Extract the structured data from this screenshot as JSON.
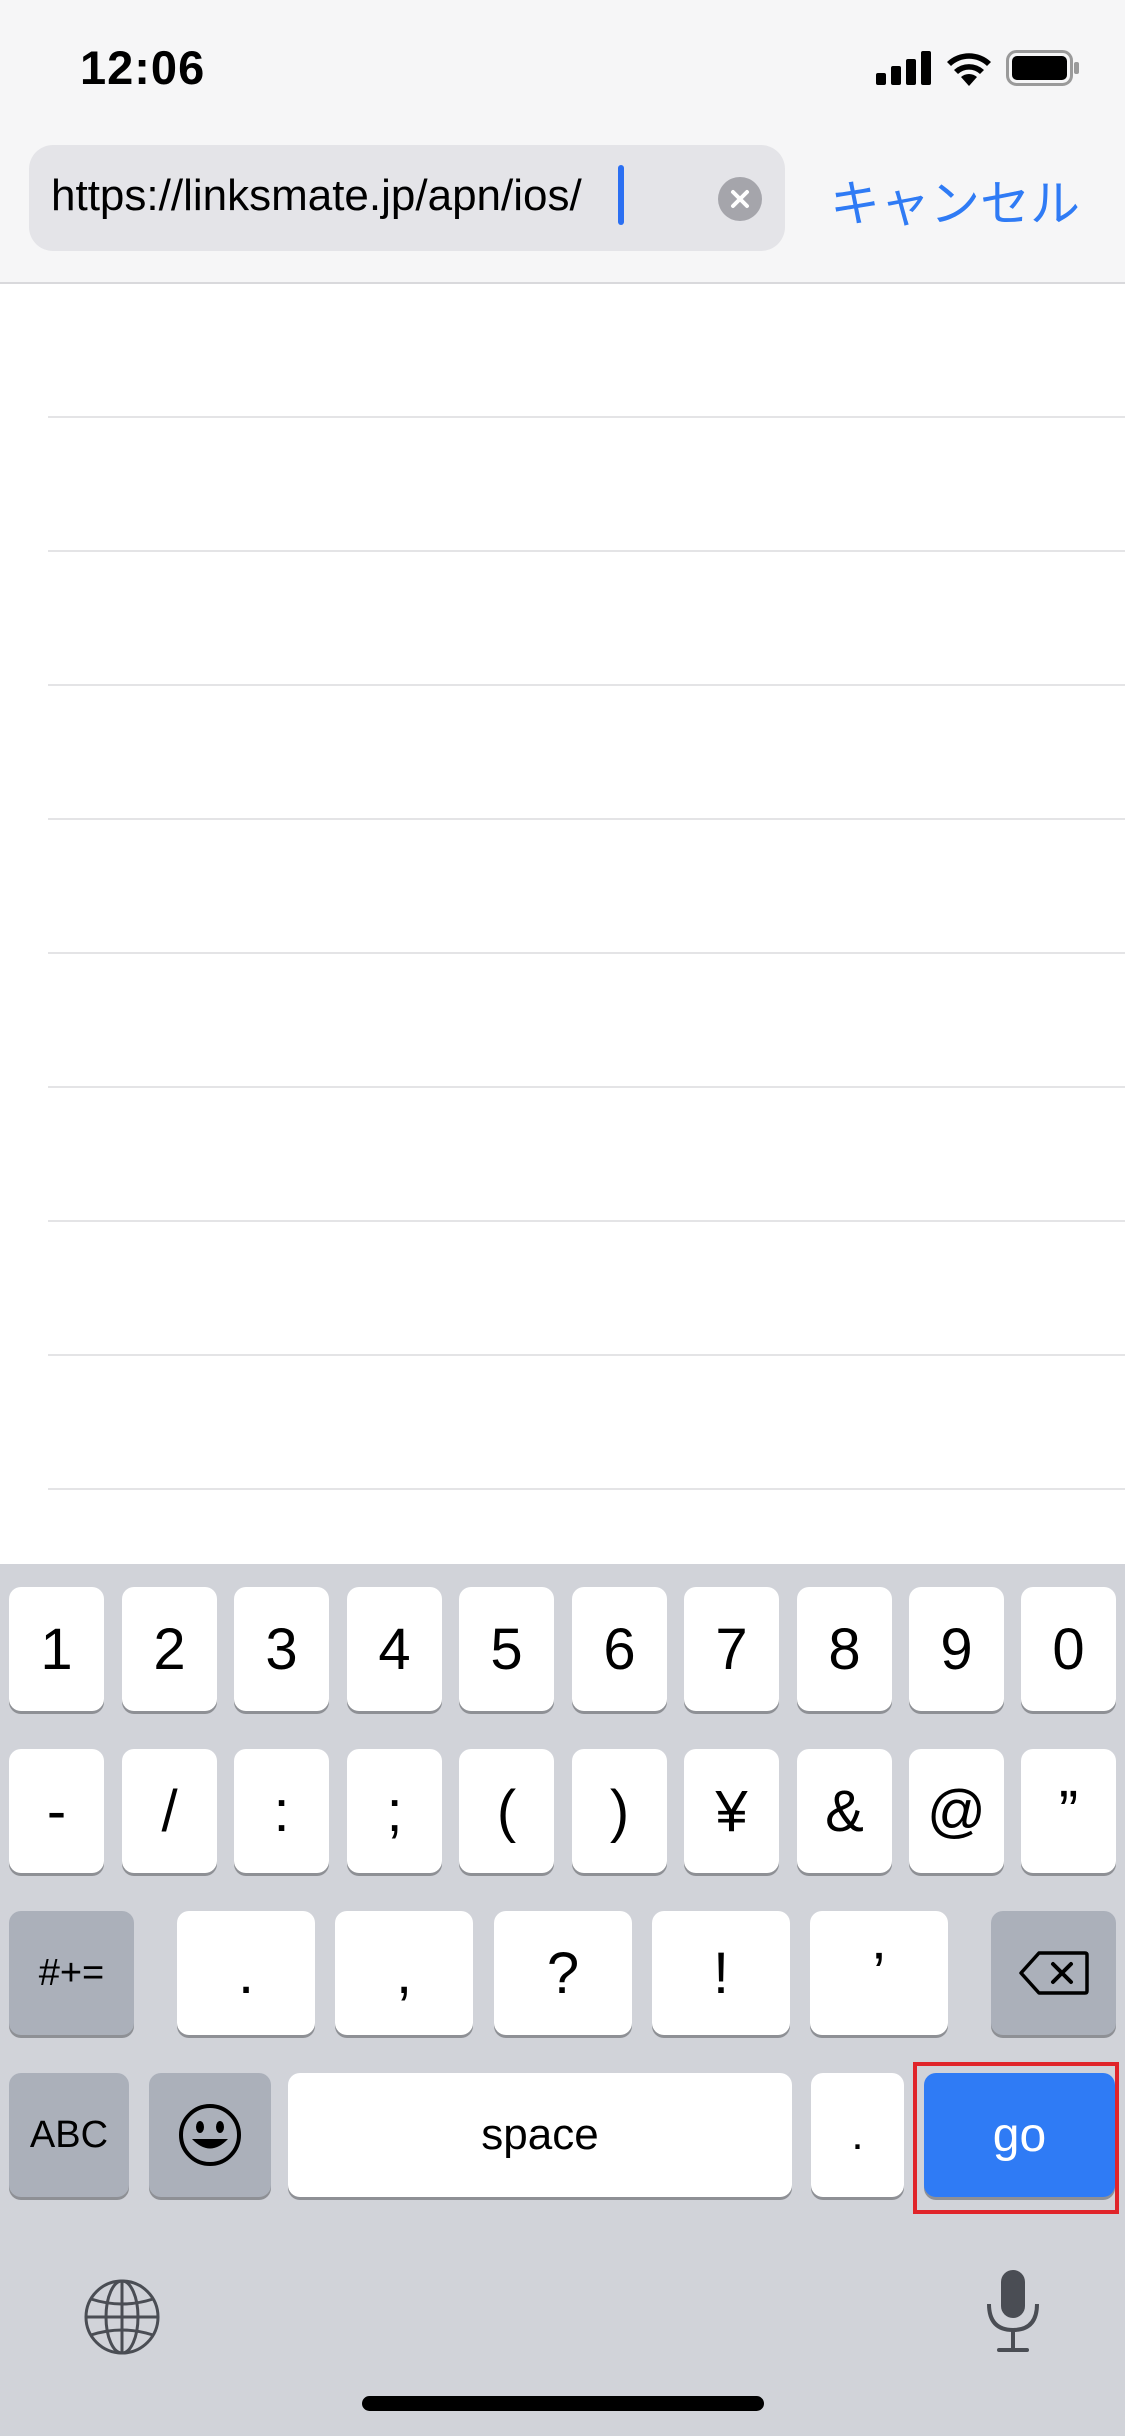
{
  "status_bar": {
    "time": "12:06",
    "icons": [
      "signal-icon",
      "wifi-icon",
      "battery-icon"
    ]
  },
  "address_bar": {
    "url_value": "https://linksmate.jp/apn/ios/",
    "cancel_label": "キャンセル"
  },
  "keyboard": {
    "row1": [
      "1",
      "2",
      "3",
      "4",
      "5",
      "6",
      "7",
      "8",
      "9",
      "0"
    ],
    "row2": [
      "-",
      "/",
      ":",
      ";",
      "(",
      ")",
      "¥",
      "&",
      "@",
      "”"
    ],
    "row3": {
      "toggle_label": "#+=",
      "keys": [
        ".",
        ",",
        "?",
        "!",
        "’"
      ],
      "delete_icon": "backspace-icon"
    },
    "row4": {
      "abc_label": "ABC",
      "emoji_icon": "emoji-icon",
      "space_label": "space",
      "dot_label": ".",
      "go_label": "go"
    },
    "bottom_icons": [
      "globe-icon",
      "microphone-icon"
    ]
  },
  "colors": {
    "accent": "#2f7bf5",
    "highlight_border": "#e0242a",
    "keyboard_bg": "#d1d3d9"
  }
}
